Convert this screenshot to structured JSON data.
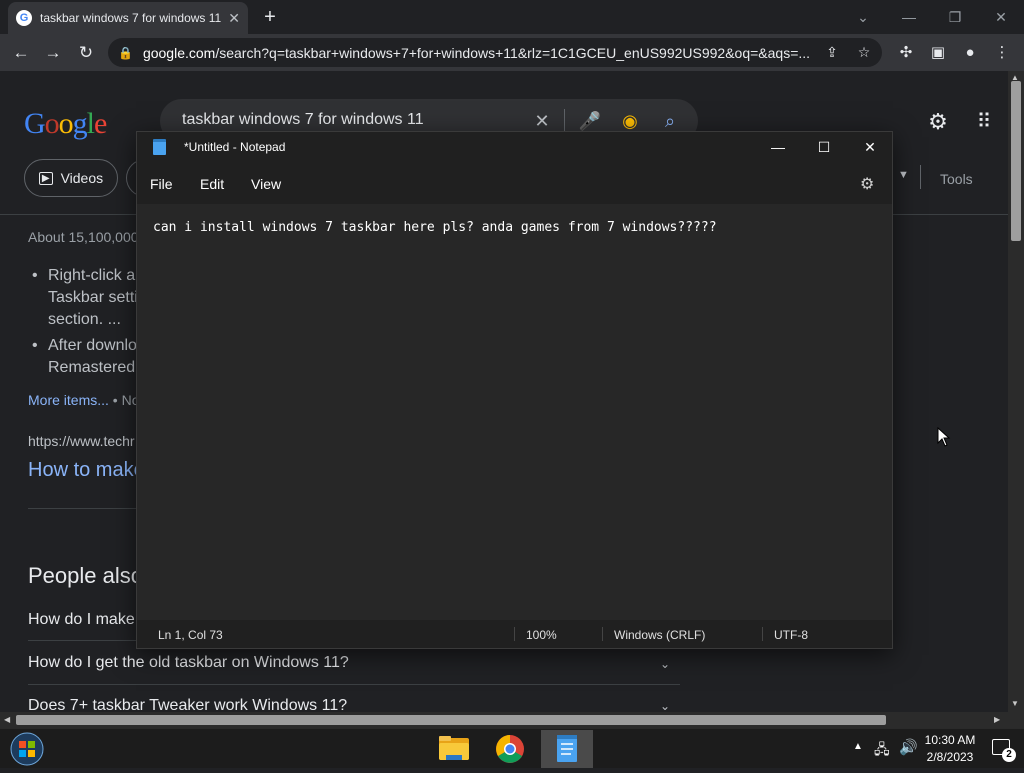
{
  "browser": {
    "tab_title": "taskbar windows 7 for windows 11",
    "url_host": "google.com",
    "url_rest": "/search?q=taskbar+windows+7+for+windows+11&rlz=1C1GCEU_enUS992US992&oq=&aqs=..."
  },
  "google": {
    "search_query": "taskbar windows 7 for windows 11",
    "videos_chip": "Videos",
    "tools": "Tools",
    "about": "About 15,100,000",
    "bullet1_l1": "Right-click a",
    "bullet1_l2": "Taskbar setti",
    "bullet1_l3": "section. ...",
    "bullet2_l1": "After downlo",
    "bullet2_l2": "Remastered",
    "more_items": "More items...",
    "more_items_sep": "• No",
    "cite": "https://www.techr",
    "result_link": "How to make",
    "paa_title": "People also",
    "paa_q1": "How do I make",
    "paa_q2": "How do I get the old taskbar on Windows 11?",
    "paa_q3": "Does 7+ taskbar Tweaker work Windows 11?"
  },
  "notepad": {
    "title": "*Untitled - Notepad",
    "menu_file": "File",
    "menu_edit": "Edit",
    "menu_view": "View",
    "content": "can i install windows 7 taskbar here pls? anda games from 7 windows?????",
    "status_pos": "Ln 1, Col 73",
    "status_zoom": "100%",
    "status_eol": "Windows (CRLF)",
    "status_enc": "UTF-8"
  },
  "taskbar": {
    "time": "10:30 AM",
    "date": "2/8/2023",
    "notification_count": "2"
  },
  "colors": {
    "link": "#8ab4f8",
    "page_bg": "#202124",
    "notepad_bg": "#272727"
  }
}
